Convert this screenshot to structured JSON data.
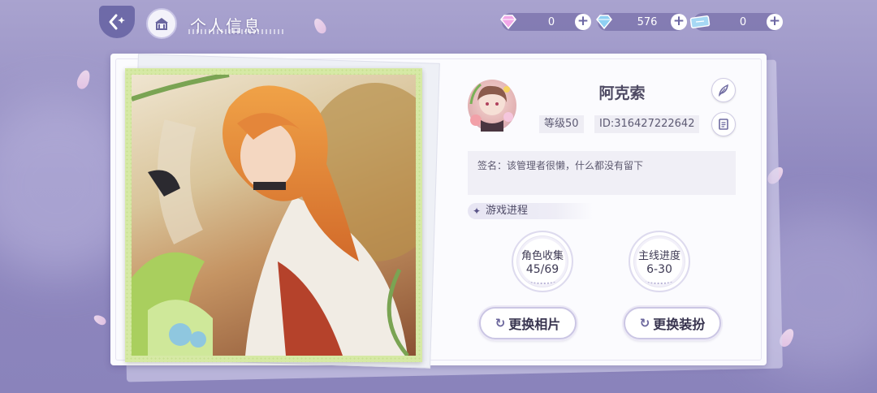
{
  "header": {
    "title": "个人信息"
  },
  "currencies": [
    {
      "name": "rainbow-diamond",
      "value": "0",
      "color": "#f2a7e8"
    },
    {
      "name": "blue-diamond",
      "value": "576",
      "color": "#8fd0f3"
    },
    {
      "name": "ticket",
      "value": "0",
      "color": "#a6d8f4"
    }
  ],
  "profile": {
    "name": "阿克索",
    "level": "等级50",
    "id": "ID:316427222642",
    "signature": "签名：该管理者很懒，什么都没有留下"
  },
  "progress": {
    "section_title": "游戏进程",
    "stats": [
      {
        "label": "角色收集",
        "value": "45/69"
      },
      {
        "label": "主线进度",
        "value": "6-30"
      }
    ]
  },
  "actions": {
    "change_photo": "更换相片",
    "change_outfit": "更换装扮"
  },
  "colors": {
    "accent": "#6e6aa8",
    "background": "#9a94c6",
    "frame": "#d6e9a5"
  }
}
